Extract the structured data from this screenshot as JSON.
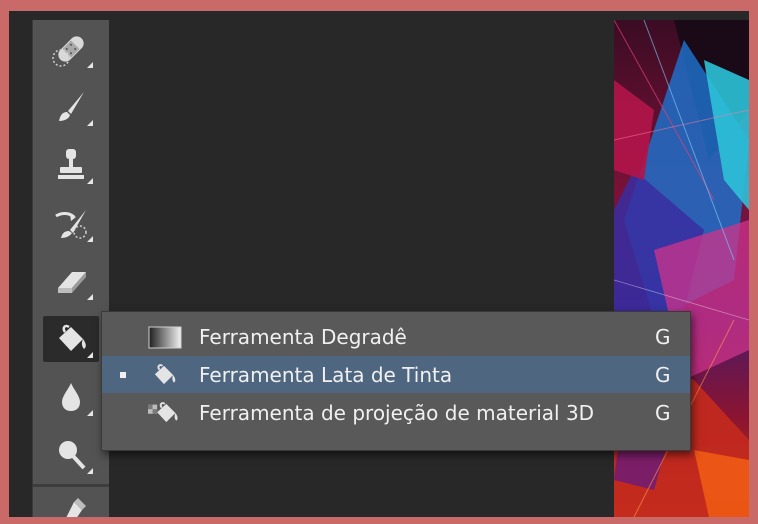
{
  "toolbar": {
    "tools": [
      {
        "name": "healing-brush-tool",
        "icon": "bandage-icon"
      },
      {
        "name": "brush-tool",
        "icon": "brush-icon"
      },
      {
        "name": "clone-stamp-tool",
        "icon": "stamp-icon"
      },
      {
        "name": "history-brush-tool",
        "icon": "history-brush-icon"
      },
      {
        "name": "eraser-tool",
        "icon": "eraser-icon"
      },
      {
        "name": "paint-bucket-tool",
        "icon": "paint-bucket-icon",
        "active": true
      },
      {
        "name": "blur-tool",
        "icon": "drop-icon"
      },
      {
        "name": "dodge-tool",
        "icon": "dodge-icon"
      },
      {
        "name": "pen-tool",
        "icon": "pen-icon"
      }
    ]
  },
  "flyout": {
    "items": [
      {
        "label": "Ferramenta Degradê",
        "shortcut": "G",
        "icon": "gradient-icon",
        "selected": false
      },
      {
        "label": "Ferramenta Lata de Tinta",
        "shortcut": "G",
        "icon": "paint-bucket-icon",
        "selected": true
      },
      {
        "label": "Ferramenta de projeção de material 3D",
        "shortcut": "G",
        "icon": "3d-material-drop-icon",
        "selected": false
      }
    ]
  },
  "colors": {
    "frame_border": "#c96a68",
    "toolbar_bg": "#535353",
    "workspace_bg": "#282828",
    "flyout_bg": "#595959",
    "flyout_selected": "#4f6680"
  }
}
